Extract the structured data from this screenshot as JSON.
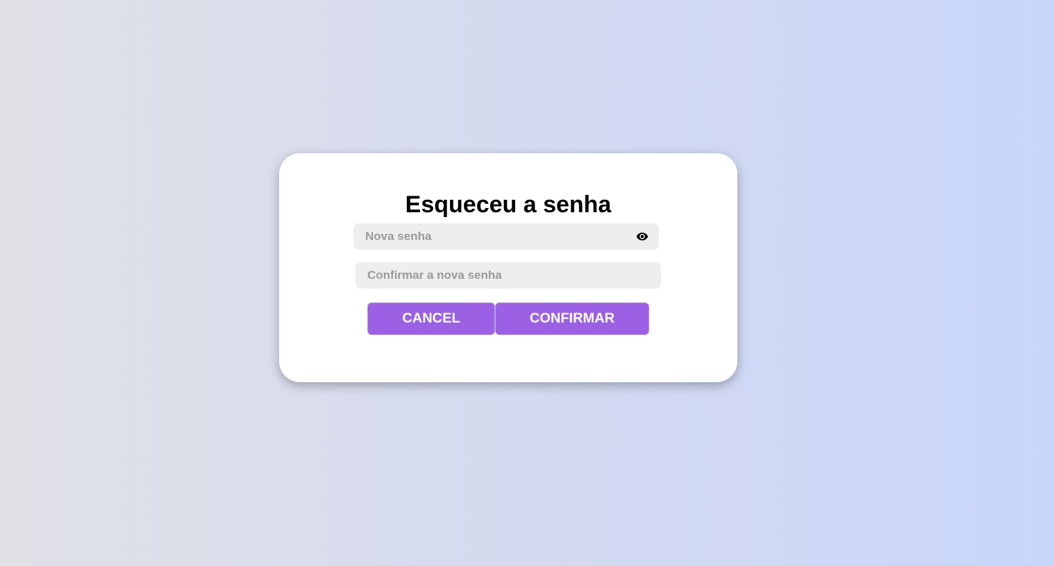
{
  "form": {
    "title": "Esqueceu a senha",
    "new_password": {
      "placeholder": "Nova senha",
      "value": "",
      "toggle_icon": "eye-icon"
    },
    "confirm_password": {
      "placeholder": "Confirmar a nova senha",
      "value": ""
    },
    "cancel_label": "CANCEL",
    "confirm_label": "CONFIRMAR"
  },
  "colors": {
    "button": "#9b60e3",
    "field_background": "#eeeeee",
    "card_background": "#ffffff"
  }
}
